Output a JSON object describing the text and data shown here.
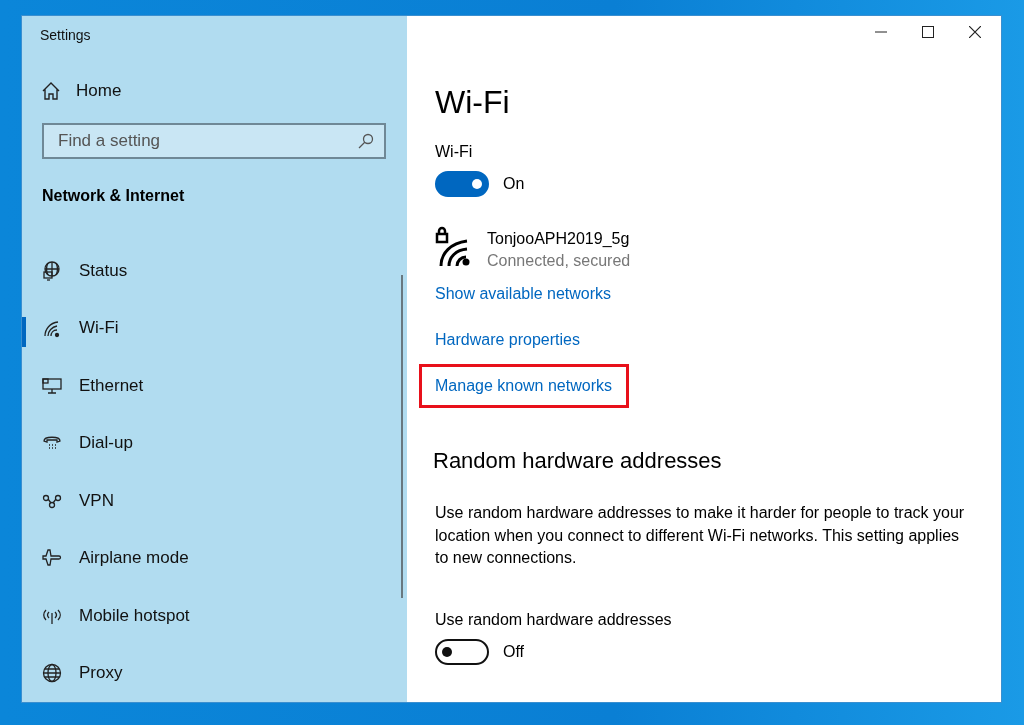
{
  "window": {
    "title": "Settings"
  },
  "sidebar": {
    "home": "Home",
    "search": {
      "placeholder": "Find a setting"
    },
    "section": "Network & Internet",
    "items": [
      {
        "label": "Status",
        "kind": "status",
        "selected": false
      },
      {
        "label": "Wi-Fi",
        "kind": "wifi",
        "selected": true
      },
      {
        "label": "Ethernet",
        "kind": "ethernet",
        "selected": false
      },
      {
        "label": "Dial-up",
        "kind": "dialup",
        "selected": false
      },
      {
        "label": "VPN",
        "kind": "vpn",
        "selected": false
      },
      {
        "label": "Airplane mode",
        "kind": "airplane",
        "selected": false
      },
      {
        "label": "Mobile hotspot",
        "kind": "hotspot",
        "selected": false
      },
      {
        "label": "Proxy",
        "kind": "proxy",
        "selected": false
      }
    ]
  },
  "main": {
    "title": "Wi-Fi",
    "wifi_toggle": {
      "label": "Wi-Fi",
      "on": true,
      "state_text": "On"
    },
    "network": {
      "name": "TonjooAPH2019_5g",
      "status": "Connected, secured"
    },
    "links": [
      {
        "label": "Show available networks",
        "highlighted": false
      },
      {
        "label": "Hardware properties",
        "highlighted": false
      },
      {
        "label": "Manage known networks",
        "highlighted": true
      }
    ],
    "random": {
      "heading": "Random hardware addresses",
      "description": "Use random hardware addresses to make it harder for people to track your location when you connect to different Wi-Fi networks. This setting applies to new connections.",
      "toggle": {
        "label": "Use random hardware addresses",
        "on": false,
        "state_text": "Off"
      }
    }
  }
}
